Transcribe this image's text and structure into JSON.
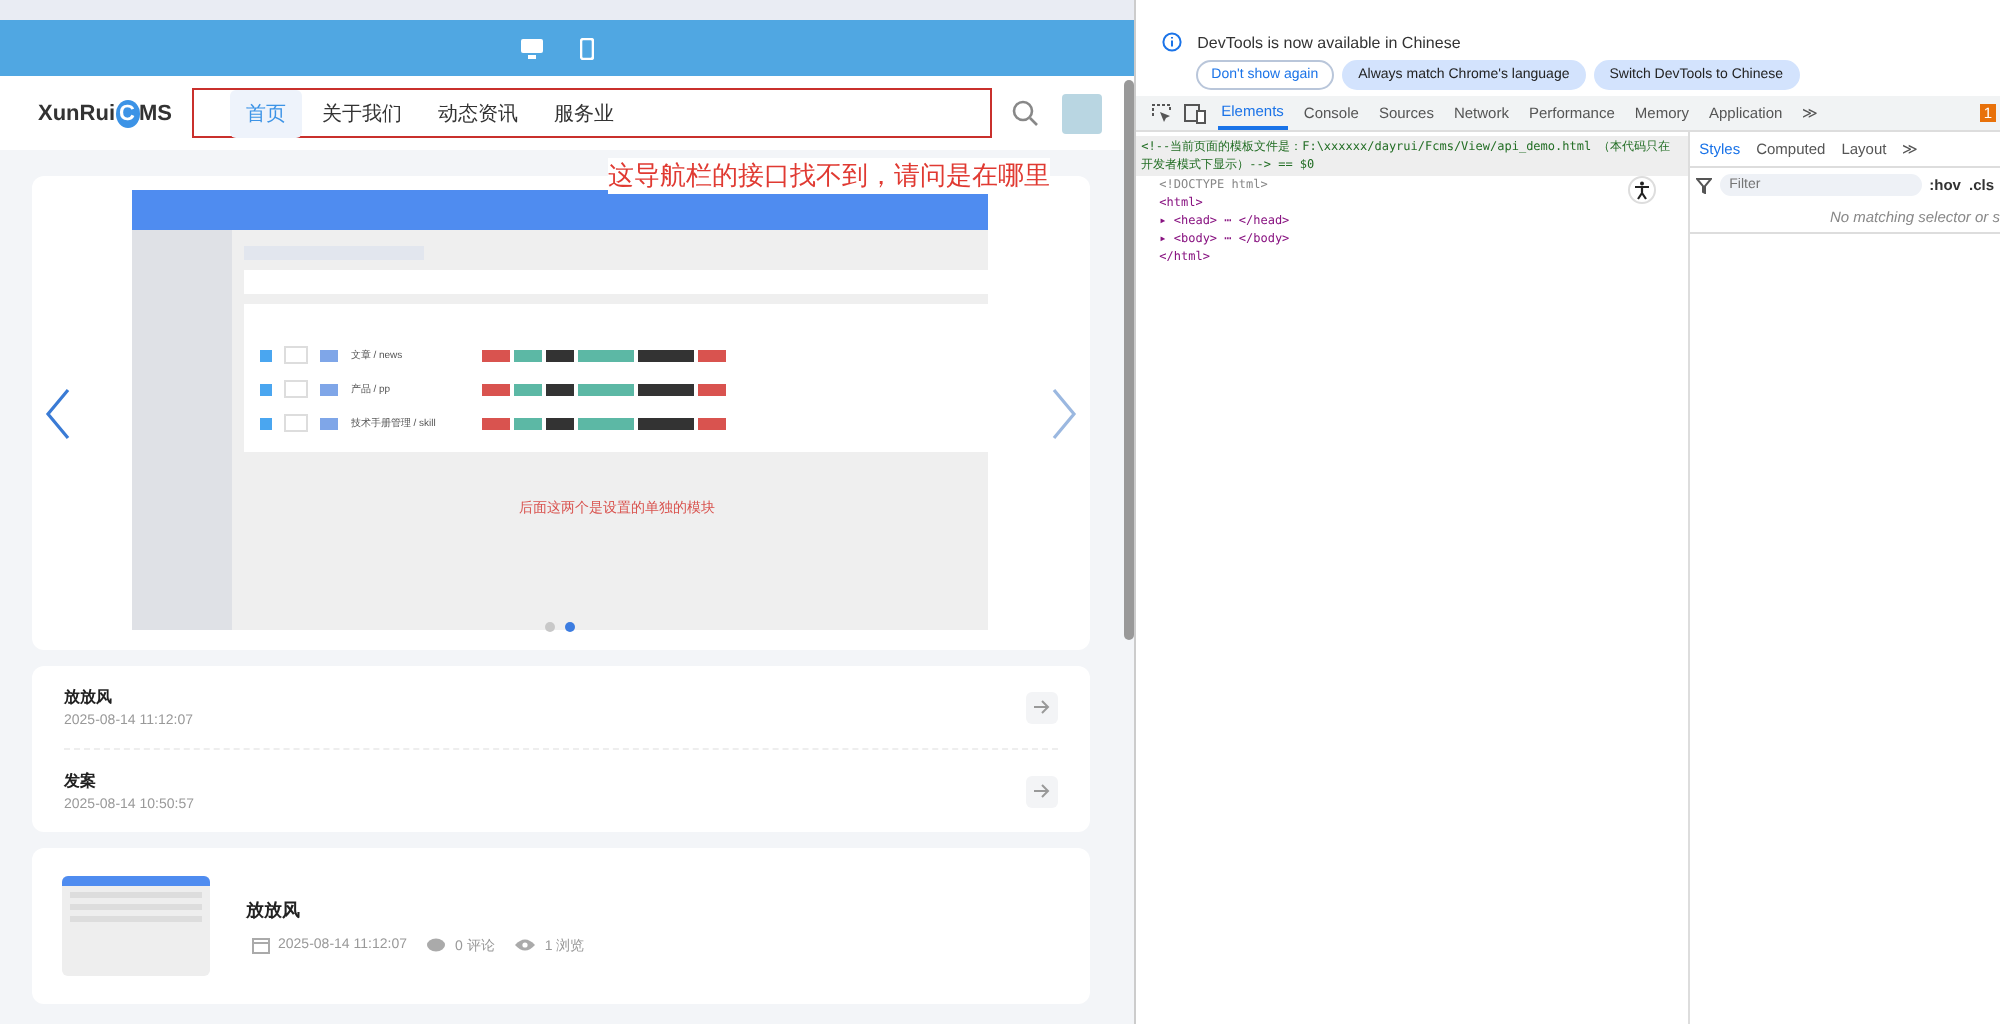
{
  "header": {
    "logo": {
      "before": "XunRui",
      "mark": "C",
      "after": "MS"
    },
    "nav": [
      {
        "label": "首页",
        "selected": true
      },
      {
        "label": "关于我们",
        "selected": false
      },
      {
        "label": "动态资讯",
        "selected": false
      },
      {
        "label": "服务业",
        "selected": false
      }
    ]
  },
  "carousel": {
    "annotation": "这导航栏的接口找不到，请问是在哪里",
    "slide": {
      "rows": [
        {
          "name": "文章 / news"
        },
        {
          "name": "产品 / pp"
        },
        {
          "name": "技术手册管理 / skill"
        }
      ],
      "caption": "后面这两个是设置的单独的模块"
    },
    "dots": [
      {
        "selected": false
      },
      {
        "selected": true
      }
    ]
  },
  "list": [
    {
      "title": "放放风",
      "date": "2025-08-14 11:12:07"
    },
    {
      "title": "发案",
      "date": "2025-08-14 10:50:57"
    }
  ],
  "article": {
    "title": "放放风",
    "date": "2025-08-14 11:12:07",
    "comments": "0 评论",
    "views": "1 浏览"
  },
  "devtools": {
    "notice": "DevTools is now available in Chinese",
    "notice_buttons": [
      {
        "label": "Don't show again",
        "kind": "outline"
      },
      {
        "label": "Always match Chrome's language",
        "kind": "filled"
      },
      {
        "label": "Switch DevTools to Chinese",
        "kind": "filled"
      }
    ],
    "tabs": [
      {
        "label": "Elements",
        "selected": true
      },
      {
        "label": "Console",
        "selected": false
      },
      {
        "label": "Sources",
        "selected": false
      },
      {
        "label": "Network",
        "selected": false
      },
      {
        "label": "Performance",
        "selected": false
      },
      {
        "label": "Memory",
        "selected": false
      },
      {
        "label": "Application",
        "selected": false
      }
    ],
    "more": "≫",
    "issues": "1",
    "dom": [
      {
        "kind": "comment",
        "text": "<!--当前页面的模板文件是：F:\\xxxxxx/dayrui/Fcms/View/api_demo.html （本代码只在开发者模式下显示）--> == $0",
        "selected": true
      },
      {
        "kind": "plain",
        "text": "<!DOCTYPE html>",
        "selected": false
      },
      {
        "kind": "tag",
        "text": "<html>",
        "selected": false
      },
      {
        "kind": "tag",
        "text": "▸ <head> ⋯ </head>",
        "selected": false
      },
      {
        "kind": "tag",
        "text": "▸ <body> ⋯ </body>",
        "selected": false
      },
      {
        "kind": "tag",
        "text": "</html>",
        "selected": false
      }
    ],
    "style_tabs": [
      {
        "label": "Styles",
        "selected": true
      },
      {
        "label": "Computed",
        "selected": false
      },
      {
        "label": "Layout",
        "selected": false
      }
    ],
    "style_more": "≫",
    "filter": {
      "placeholder": "Filter"
    },
    "hov": ":hov",
    "cls": ".cls",
    "empty": "No matching selector or s"
  }
}
